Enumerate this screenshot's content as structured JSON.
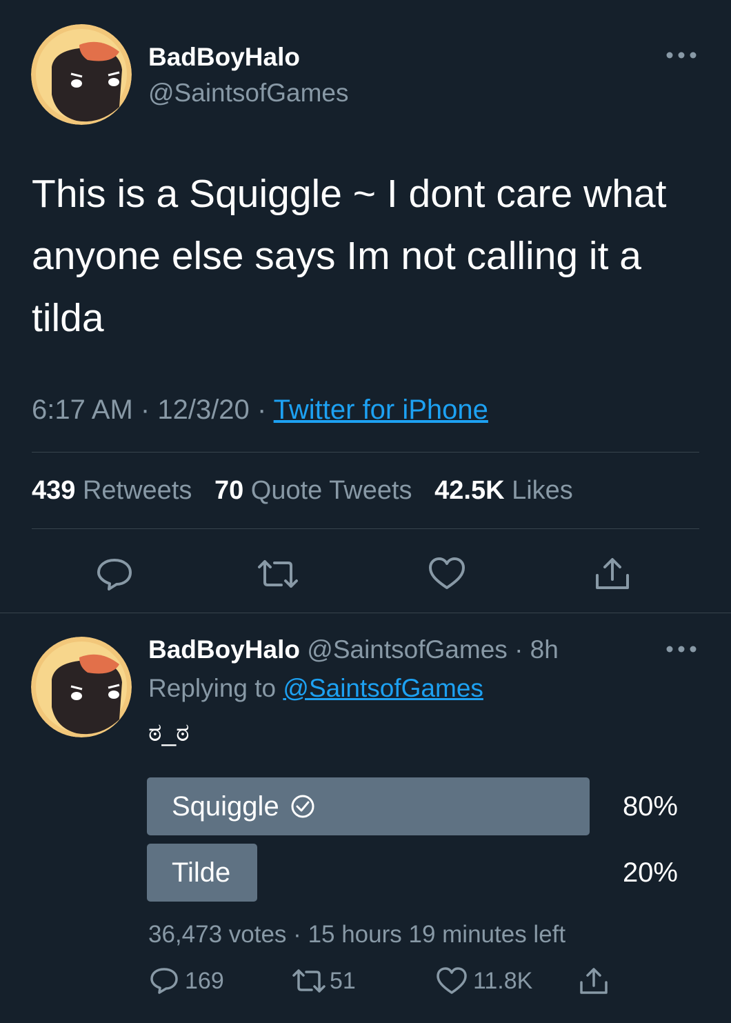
{
  "tweet": {
    "author": {
      "name": "BadBoyHalo",
      "handle": "@SaintsofGames"
    },
    "more_icon": "more-horizontal-icon",
    "text_lines": [
      "This is a Squiggle ~ I dont care what",
      "anyone else says Im not calling it a",
      "tilda"
    ],
    "time": "6:17 AM",
    "sep": "·",
    "date": "12/3/20",
    "source": "Twitter for iPhone",
    "stats": {
      "retweets_count": "439",
      "retweets_label": "Retweets",
      "quotes_count": "70",
      "quotes_label": "Quote Tweets",
      "likes_count": "42.5K",
      "likes_label": "Likes"
    },
    "actions": [
      "reply-icon",
      "retweet-icon",
      "like-icon",
      "share-icon"
    ]
  },
  "reply": {
    "author": {
      "name": "BadBoyHalo",
      "handle": "@SaintsofGames",
      "time": "· 8h"
    },
    "replying_prefix": "Replying to",
    "replying_to": "@SaintsofGames",
    "text": "ಠ_ಠ",
    "poll": {
      "options": [
        {
          "label": "Squiggle",
          "percent": "80%",
          "fraction": 0.8,
          "winner": true
        },
        {
          "label": "Tilde",
          "percent": "20%",
          "fraction": 0.2,
          "winner": false
        }
      ],
      "votes": "36,473 votes",
      "sep": "·",
      "time_left": "15 hours 19 minutes left"
    },
    "actions": {
      "replies": "169",
      "retweets": "51",
      "likes": "11.8K"
    }
  },
  "colors": {
    "background": "#15202b",
    "text": "#ffffff",
    "secondary": "#8899a6",
    "link": "#1da1f2",
    "poll_bar": "#5f7283",
    "divider": "#38444d"
  }
}
